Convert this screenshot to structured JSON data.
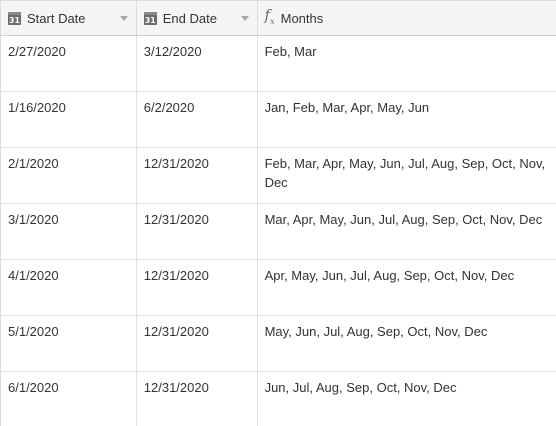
{
  "columns": [
    {
      "label": "Start Date",
      "icon": "calendar-icon",
      "icon_text": "31"
    },
    {
      "label": "End Date",
      "icon": "calendar-icon",
      "icon_text": "31"
    },
    {
      "label": "Months",
      "icon": "formula-icon",
      "icon_text": "fx"
    }
  ],
  "rows": [
    {
      "start": "2/27/2020",
      "end": "3/12/2020",
      "months": "Feb, Mar"
    },
    {
      "start": "1/16/2020",
      "end": "6/2/2020",
      "months": "Jan, Feb, Mar, Apr, May, Jun"
    },
    {
      "start": "2/1/2020",
      "end": "12/31/2020",
      "months": "Feb, Mar, Apr, May, Jun, Jul, Aug, Sep, Oct, Nov, Dec"
    },
    {
      "start": "3/1/2020",
      "end": "12/31/2020",
      "months": "Mar, Apr, May, Jun, Jul, Aug, Sep, Oct, Nov, Dec"
    },
    {
      "start": "4/1/2020",
      "end": "12/31/2020",
      "months": "Apr, May, Jun, Jul, Aug, Sep, Oct, Nov, Dec"
    },
    {
      "start": "5/1/2020",
      "end": "12/31/2020",
      "months": "May, Jun, Jul, Aug, Sep, Oct, Nov, Dec"
    },
    {
      "start": "6/1/2020",
      "end": "12/31/2020",
      "months": "Jun, Jul, Aug, Sep, Oct, Nov, Dec"
    }
  ]
}
